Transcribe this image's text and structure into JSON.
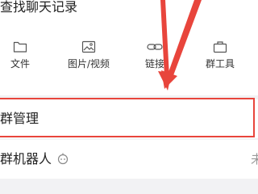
{
  "search": {
    "title": "查找聊天记录"
  },
  "tools": [
    {
      "label": "文件",
      "icon": "folder-icon"
    },
    {
      "label": "图片/视频",
      "icon": "image-icon"
    },
    {
      "label": "链接",
      "icon": "link-icon"
    },
    {
      "label": "群工具",
      "icon": "toolbox-icon"
    }
  ],
  "rows": {
    "group_manage": {
      "label": "群管理"
    },
    "group_robot": {
      "label": "群机器人",
      "value": "未"
    }
  },
  "annotations": {
    "highlight_color": "#e8453c",
    "arrow_color": "#e8453c"
  }
}
